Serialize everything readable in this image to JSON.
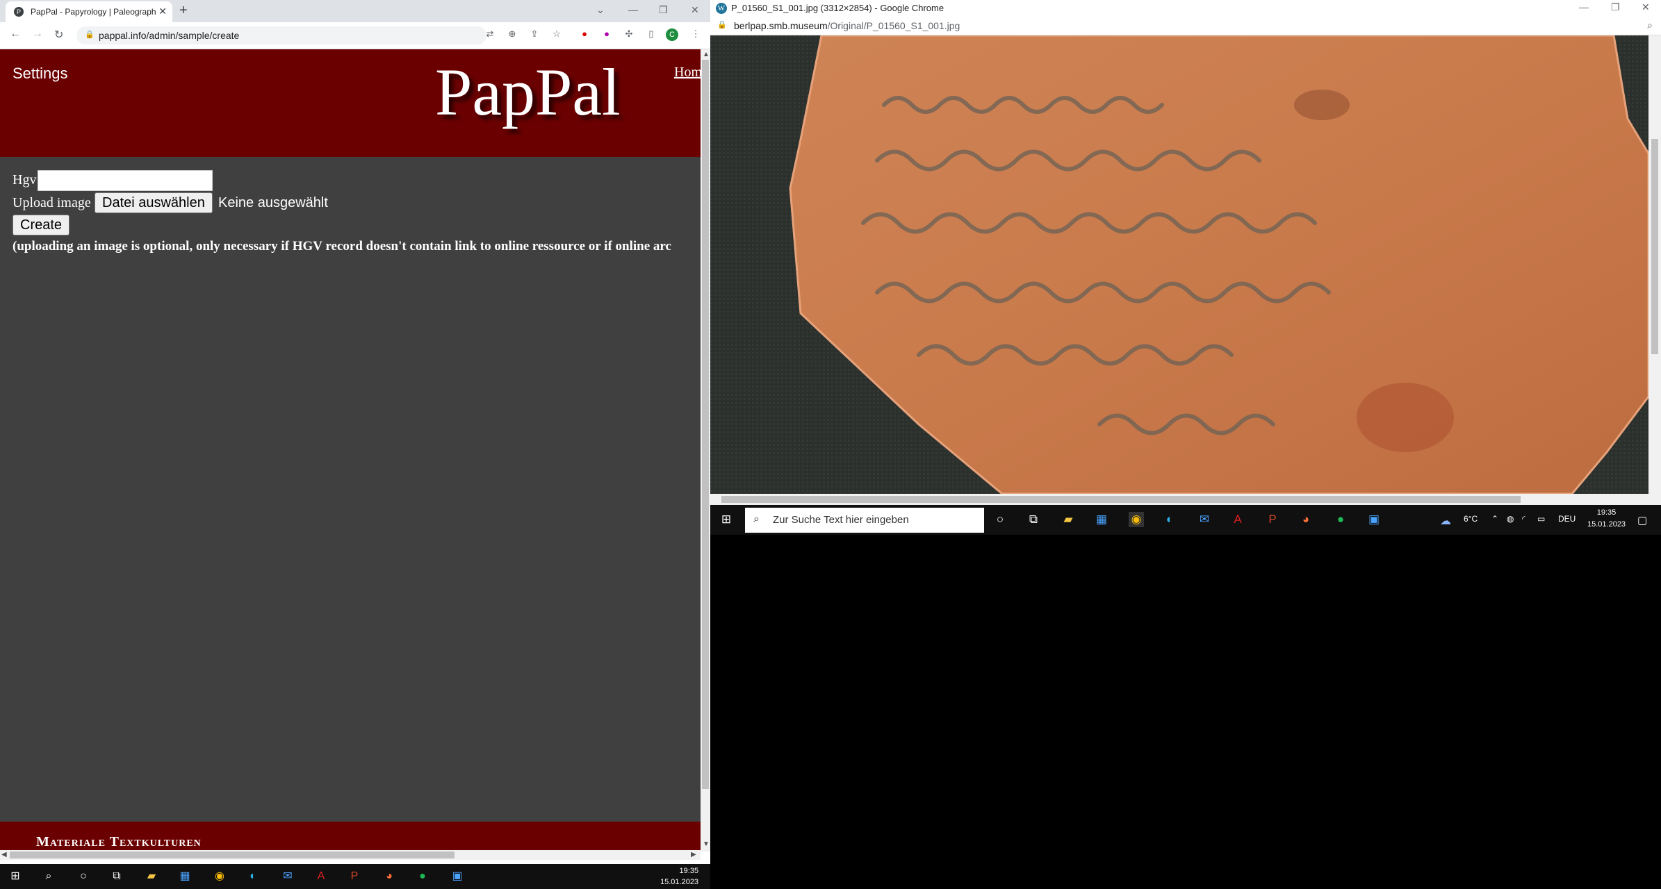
{
  "left_browser": {
    "tab_title": "PapPal - Papyrology | Paleography",
    "url": "pappal.info/admin/sample/create",
    "profile_initial": "C"
  },
  "page": {
    "settings_label": "Settings",
    "logo_text": "PapPal",
    "home_link": "Hom",
    "hgv_label": "Hgv",
    "hgv_value": "",
    "upload_label": "Upload image",
    "file_button": "Datei auswählen",
    "file_status": "Keine ausgewählt",
    "create_button": "Create",
    "note": "(uploading an image is optional, only necessary if HGV record doesn't contain link to online ressource or if online arc",
    "footer_text": "Materiale Textkulturen"
  },
  "right_browser": {
    "title": "P_01560_S1_001.jpg (3312×2854) - Google Chrome",
    "url_host": "berlpap.smb.museum",
    "url_path": "/Original/P_01560_S1_001.jpg"
  },
  "taskbar": {
    "search_placeholder": "Zur Suche Text hier eingeben",
    "weather": "6°C",
    "language": "DEU",
    "time": "19:35",
    "date": "15.01.2023"
  },
  "colors": {
    "banner": "#6b0000",
    "page_bg": "#404040",
    "sherd": "#c9784a"
  }
}
